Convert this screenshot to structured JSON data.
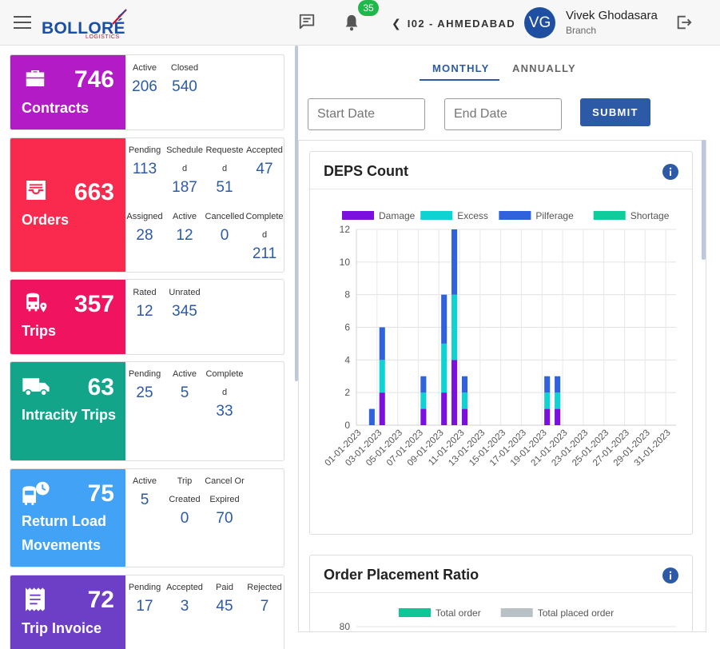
{
  "header": {
    "logo": {
      "brand": "BOLLORÉ",
      "sub": "LOGISTICS"
    },
    "notifications": {
      "count": "35"
    },
    "branch": "I02 - AHMEDABAD",
    "user": {
      "initials": "VG",
      "name": "Vivek Ghodasara",
      "role": "Branch"
    }
  },
  "cards": [
    {
      "title": "Contracts",
      "count": "746",
      "color": "#b31bc7",
      "icon": "briefcase-icon",
      "stats": [
        {
          "label": "Active",
          "value": "206"
        },
        {
          "label": "Closed",
          "value": "540"
        }
      ]
    },
    {
      "title": "Orders",
      "count": "663",
      "color": "#fa2a4e",
      "icon": "inbox-icon",
      "stats": [
        {
          "label": "Pending",
          "value": "113"
        },
        {
          "label": "Scheduled",
          "value": "187"
        },
        {
          "label": "Requested",
          "value": "51"
        },
        {
          "label": "Accepted",
          "value": "47"
        },
        {
          "label": "Assigned",
          "value": "28"
        },
        {
          "label": "Active",
          "value": "12"
        },
        {
          "label": "Cancelled",
          "value": "0"
        },
        {
          "label": "Completed",
          "value": "211"
        }
      ]
    },
    {
      "title": "Trips",
      "count": "357",
      "color": "#f0135f",
      "icon": "bus-location-icon",
      "stats": [
        {
          "label": "Rated",
          "value": "12"
        },
        {
          "label": "Unrated",
          "value": "345"
        }
      ]
    },
    {
      "title": "Intracity Trips",
      "count": "63",
      "color": "#13a58a",
      "icon": "truck-icon",
      "stats": [
        {
          "label": "Pending",
          "value": "25"
        },
        {
          "label": "Active",
          "value": "5"
        },
        {
          "label": "Completed",
          "value": "33"
        }
      ]
    },
    {
      "title": "Return Load Movements",
      "count": "75",
      "color": "#42a2f5",
      "icon": "bus-clock-icon",
      "stats": [
        {
          "label": "Active",
          "value": "5"
        },
        {
          "label": "Trip Created",
          "value": "0"
        },
        {
          "label": "Cancel Or Expired",
          "value": "70"
        }
      ]
    },
    {
      "title": "Trip Invoice",
      "count": "72",
      "color": "#6d3fc6",
      "icon": "receipt-icon",
      "stats": [
        {
          "label": "Pending",
          "value": "17"
        },
        {
          "label": "Accepted",
          "value": "3"
        },
        {
          "label": "Paid",
          "value": "45"
        },
        {
          "label": "Rejected",
          "value": "7"
        }
      ]
    }
  ],
  "tabs": [
    {
      "label": "MONTHLY",
      "active": true
    },
    {
      "label": "ANNUALLY",
      "active": false
    }
  ],
  "filters": {
    "start_placeholder": "Start Date",
    "end_placeholder": "End Date",
    "submit_label": "SUBMIT"
  },
  "chart_data": [
    {
      "type": "bar",
      "title": "DEPS Count",
      "stacked": true,
      "legend_position": "top",
      "x": [
        "01-01-2023",
        "02-01-2023",
        "03-01-2023",
        "04-01-2023",
        "05-01-2023",
        "06-01-2023",
        "07-01-2023",
        "08-01-2023",
        "09-01-2023",
        "10-01-2023",
        "11-01-2023",
        "12-01-2023",
        "13-01-2023",
        "14-01-2023",
        "15-01-2023",
        "16-01-2023",
        "17-01-2023",
        "18-01-2023",
        "19-01-2023",
        "20-01-2023",
        "21-01-2023",
        "22-01-2023",
        "23-01-2023",
        "24-01-2023",
        "25-01-2023",
        "26-01-2023",
        "27-01-2023",
        "28-01-2023",
        "29-01-2023",
        "30-01-2023",
        "31-01-2023"
      ],
      "x_tick_labels": [
        "01-01-2023",
        "03-01-2023",
        "05-01-2023",
        "07-01-2023",
        "09-01-2023",
        "11-01-2023",
        "13-01-2023",
        "15-01-2023",
        "17-01-2023",
        "19-01-2023",
        "21-01-2023",
        "23-01-2023",
        "25-01-2023",
        "27-01-2023",
        "29-01-2023",
        "31-01-2023"
      ],
      "ylim": [
        0,
        12
      ],
      "y_ticks": [
        0,
        2,
        4,
        6,
        8,
        10,
        12
      ],
      "series": [
        {
          "name": "Damage",
          "color": "#7b0fe0",
          "values": [
            0,
            0,
            2,
            0,
            0,
            0,
            1,
            0,
            2,
            4,
            1,
            0,
            0,
            0,
            0,
            0,
            0,
            0,
            1,
            1,
            0,
            0,
            0,
            0,
            0,
            0,
            0,
            0,
            0,
            0,
            0
          ]
        },
        {
          "name": "Excess",
          "color": "#0fd3d3",
          "values": [
            0,
            0,
            2,
            0,
            0,
            0,
            1,
            0,
            3,
            4,
            1,
            0,
            0,
            0,
            0,
            0,
            0,
            0,
            1,
            1,
            0,
            0,
            0,
            0,
            0,
            0,
            0,
            0,
            0,
            0,
            0
          ]
        },
        {
          "name": "Pilferage",
          "color": "#2f62dc",
          "values": [
            0,
            1,
            2,
            0,
            0,
            0,
            1,
            0,
            3,
            4,
            1,
            0,
            0,
            0,
            0,
            0,
            0,
            0,
            1,
            1,
            0,
            0,
            0,
            0,
            0,
            0,
            0,
            0,
            0,
            0,
            0
          ]
        },
        {
          "name": "Shortage",
          "color": "#0fcd9a",
          "values": [
            0,
            0,
            0,
            0,
            0,
            0,
            0,
            0,
            0,
            0,
            0,
            0,
            0,
            0,
            0,
            0,
            0,
            0,
            0,
            0,
            0,
            0,
            0,
            0,
            0,
            0,
            0,
            0,
            0,
            0,
            0
          ]
        }
      ]
    },
    {
      "type": "bar",
      "title": "Order Placement Ratio",
      "legend_position": "top",
      "y_ticks_visible": [
        80
      ],
      "series": [
        {
          "name": "Total order",
          "color": "#0fc796"
        },
        {
          "name": "Total placed order",
          "color": "#b7c1c6"
        }
      ]
    }
  ]
}
